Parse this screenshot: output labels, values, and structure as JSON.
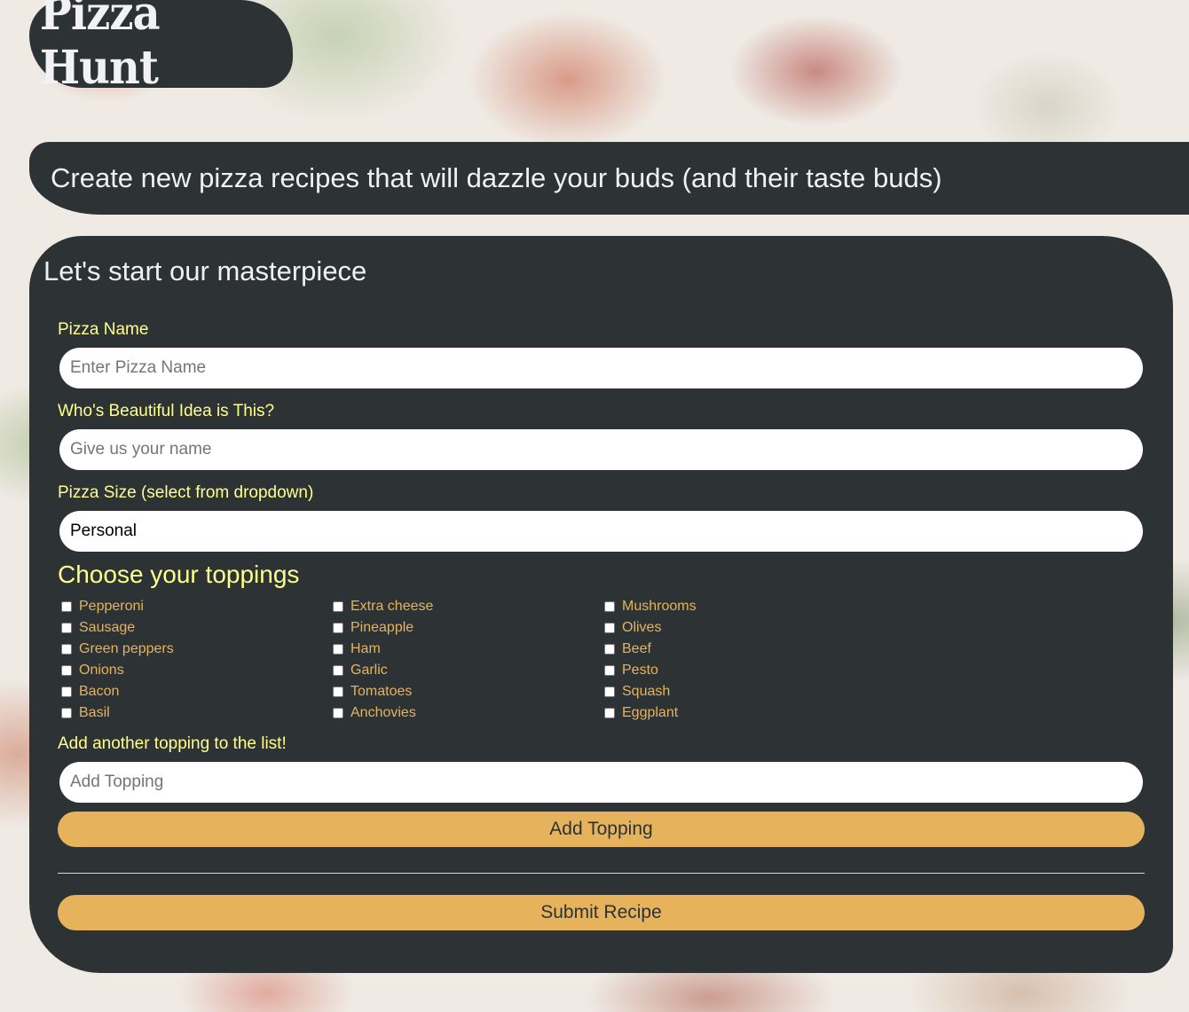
{
  "brand": {
    "logo_text": "Pizza Hunt"
  },
  "header": {
    "tagline": "Create new pizza recipes that will dazzle your buds (and their taste buds)"
  },
  "form": {
    "title": "Let's start our masterpiece",
    "pizza_name": {
      "label": "Pizza Name",
      "placeholder": "Enter Pizza Name",
      "value": ""
    },
    "creator": {
      "label": "Who's Beautiful Idea is This?",
      "placeholder": "Give us your name",
      "value": ""
    },
    "size": {
      "label": "Pizza Size (select from dropdown)",
      "selected": "Personal"
    },
    "toppings": {
      "title": "Choose your toppings",
      "columns": [
        [
          "Pepperoni",
          "Sausage",
          "Green peppers",
          "Onions",
          "Bacon",
          "Basil"
        ],
        [
          "Extra cheese",
          "Pineapple",
          "Ham",
          "Garlic",
          "Tomatoes",
          "Anchovies"
        ],
        [
          "Mushrooms",
          "Olives",
          "Beef",
          "Pesto",
          "Squash",
          "Eggplant"
        ]
      ]
    },
    "add_topping": {
      "label": "Add another topping to the list!",
      "placeholder": "Add Topping",
      "button": "Add Topping"
    },
    "submit_button": "Submit Recipe"
  },
  "colors": {
    "panel": "#2d3235",
    "label_yellow": "#ffff8c",
    "accent_gold": "#e6b35c",
    "text_light": "#f0f0f0"
  }
}
